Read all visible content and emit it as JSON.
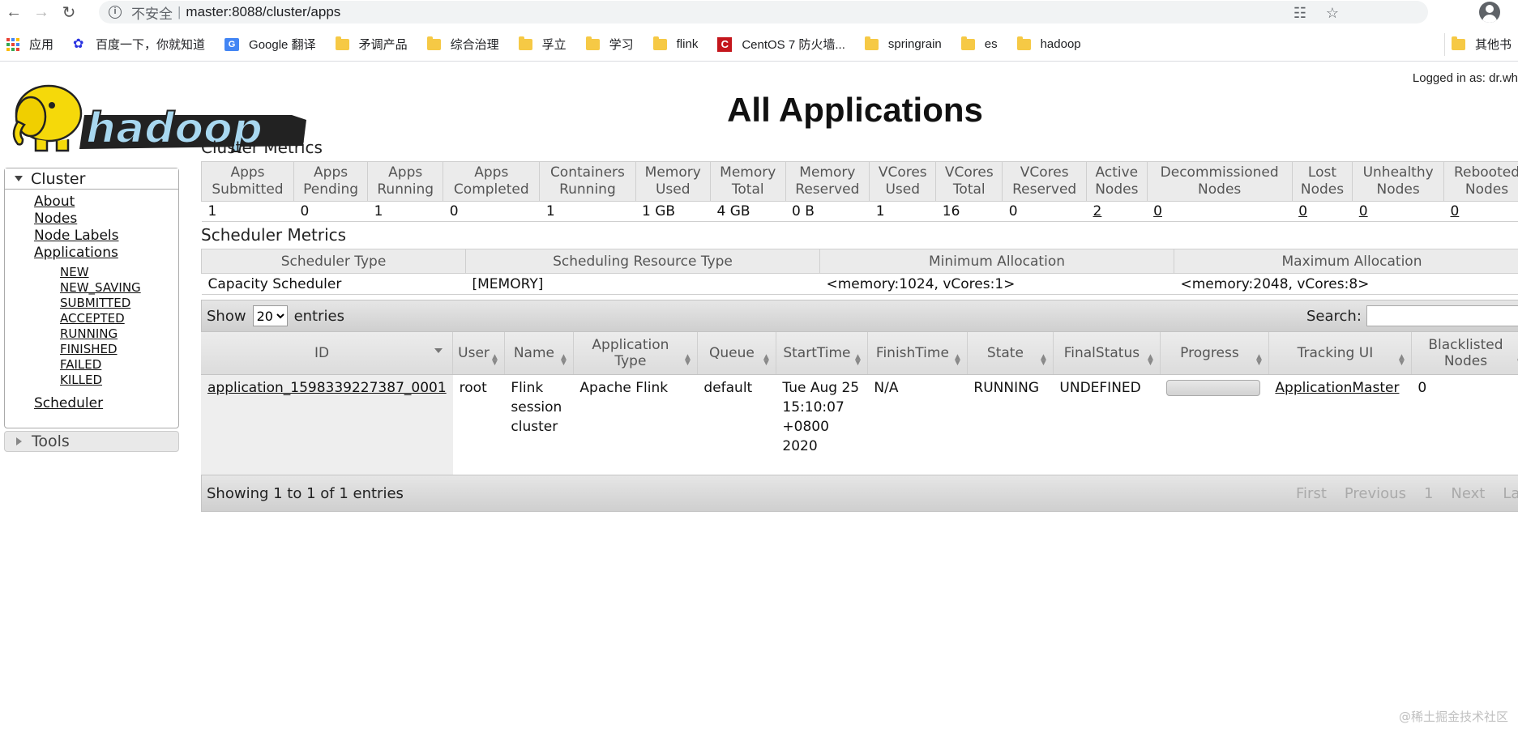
{
  "browser": {
    "security_label": "不安全",
    "url": "master:8088/cluster/apps",
    "bookmarks": [
      {
        "label": "应用",
        "icon": "apps-grid-icon"
      },
      {
        "label": "百度一下，你就知道",
        "icon": "baidu-icon"
      },
      {
        "label": "Google 翻译",
        "icon": "google-translate-icon"
      },
      {
        "label": "矛调产品",
        "icon": "folder-icon"
      },
      {
        "label": "综合治理",
        "icon": "folder-icon"
      },
      {
        "label": "孚立",
        "icon": "folder-icon"
      },
      {
        "label": "学习",
        "icon": "folder-icon"
      },
      {
        "label": "flink",
        "icon": "folder-icon"
      },
      {
        "label": "CentOS 7 防火墙...",
        "icon": "centos-icon"
      },
      {
        "label": "springrain",
        "icon": "folder-icon"
      },
      {
        "label": "es",
        "icon": "folder-icon"
      },
      {
        "label": "hadoop",
        "icon": "folder-icon"
      },
      {
        "label": "其他书",
        "icon": "folder-icon"
      }
    ]
  },
  "header": {
    "logged_in": "Logged in as: dr.wh",
    "title": "All Applications"
  },
  "nav": {
    "cluster_label": "Cluster",
    "links": [
      "About",
      "Nodes",
      "Node Labels",
      "Applications"
    ],
    "app_states": [
      "NEW",
      "NEW_SAVING",
      "SUBMITTED",
      "ACCEPTED",
      "RUNNING",
      "FINISHED",
      "FAILED",
      "KILLED"
    ],
    "scheduler": "Scheduler",
    "tools_label": "Tools"
  },
  "cluster_metrics": {
    "title": "Cluster Metrics",
    "headers": [
      [
        "Apps",
        "Submitted"
      ],
      [
        "Apps",
        "Pending"
      ],
      [
        "Apps",
        "Running"
      ],
      [
        "Apps",
        "Completed"
      ],
      [
        "Containers",
        "Running"
      ],
      [
        "Memory",
        "Used"
      ],
      [
        "Memory",
        "Total"
      ],
      [
        "Memory",
        "Reserved"
      ],
      [
        "VCores",
        "Used"
      ],
      [
        "VCores",
        "Total"
      ],
      [
        "VCores",
        "Reserved"
      ],
      [
        "Active",
        "Nodes"
      ],
      [
        "Decommissioned",
        "Nodes"
      ],
      [
        "Lost",
        "Nodes"
      ],
      [
        "Unhealthy",
        "Nodes"
      ],
      [
        "Rebooted",
        "Nodes"
      ]
    ],
    "values": [
      "1",
      "0",
      "1",
      "0",
      "1",
      "1 GB",
      "4 GB",
      "0 B",
      "1",
      "16",
      "0",
      "2",
      "0",
      "0",
      "0",
      "0"
    ]
  },
  "scheduler_metrics": {
    "title": "Scheduler Metrics",
    "headers": [
      "Scheduler Type",
      "Scheduling Resource Type",
      "Minimum Allocation",
      "Maximum Allocation"
    ],
    "values": [
      "Capacity Scheduler",
      "[MEMORY]",
      "<memory:1024, vCores:1>",
      "<memory:2048, vCores:8>"
    ]
  },
  "apps_table": {
    "show_label": "Show",
    "entries_value": "20",
    "entries_label": "entries",
    "search_label": "Search:",
    "headers": [
      "ID",
      "User",
      "Name",
      "Application Type",
      "Queue",
      "StartTime",
      "FinishTime",
      "State",
      "FinalStatus",
      "Progress",
      "Tracking UI",
      "Blacklisted Nodes"
    ],
    "rows": [
      {
        "id": "application_1598339227387_0001",
        "user": "root",
        "name": "Flink session cluster",
        "type": "Apache Flink",
        "queue": "default",
        "start_time": "Tue Aug 25 15:10:07 +0800 2020",
        "finish_time": "N/A",
        "state": "RUNNING",
        "final_status": "UNDEFINED",
        "progress": 0,
        "tracking_ui": "ApplicationMaster",
        "blacklisted": "0"
      }
    ],
    "footer_info": "Showing 1 to 1 of 1 entries",
    "pager": [
      "First",
      "Previous",
      "1",
      "Next",
      "Last"
    ]
  },
  "watermark": "@稀土掘金技术社区"
}
